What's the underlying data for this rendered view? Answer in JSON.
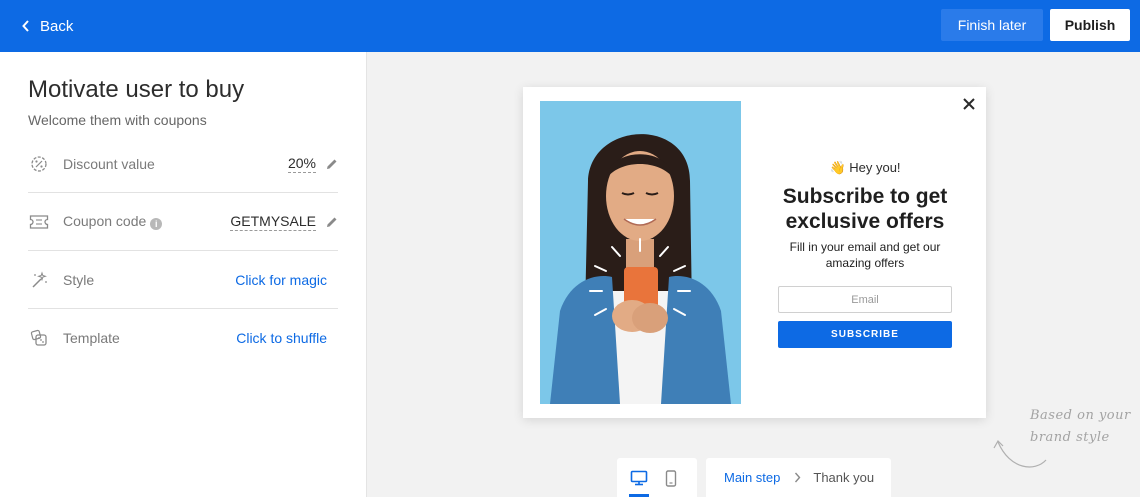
{
  "header": {
    "back_label": "Back",
    "finish_later_label": "Finish later",
    "publish_label": "Publish"
  },
  "sidebar": {
    "title": "Motivate user to buy",
    "subtitle": "Welcome them with coupons",
    "rows": [
      {
        "label": "Discount value",
        "value": "20%",
        "icon": "discount-icon"
      },
      {
        "label": "Coupon code",
        "value": "GETMYSALE",
        "icon": "ticket-icon"
      },
      {
        "label": "Style",
        "link": "Click for magic",
        "icon": "magic-wand-icon"
      },
      {
        "label": "Template",
        "link": "Click to shuffle",
        "icon": "dice-icon"
      }
    ]
  },
  "popup": {
    "greeting": "👋 Hey you!",
    "headline": "Subscribe to get exclusive offers",
    "description": "Fill in your email and get our amazing offers",
    "email_placeholder": "Email",
    "button_label": "SUBSCRIBE"
  },
  "hint": {
    "line1": "Based on your",
    "line2": "brand style"
  },
  "steps": {
    "main": "Main step",
    "thank_you": "Thank you"
  },
  "colors": {
    "accent": "#0d6ae4",
    "photo_background": "#7cc7e9"
  }
}
